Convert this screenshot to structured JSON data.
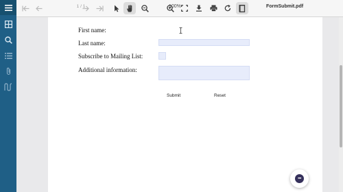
{
  "toolbar": {
    "page_indicator": "1 / 1",
    "zoom_level": "100%",
    "file_name": "FormSubmit.pdf"
  },
  "form": {
    "first_name_label": "First name:",
    "last_name_label": "Last name:",
    "subscribe_label": "Subscribe to Mailing List:",
    "additional_label": "Additional information:",
    "first_name_value": "",
    "last_name_value": "",
    "additional_value": "",
    "submit_label": "Submit",
    "reset_label": "Reset"
  },
  "colors": {
    "sidebar": "#1f5f86",
    "field_fill": "#e7ecfb",
    "chat_icon": "#35305b"
  },
  "icons": {
    "sidebar": [
      "menu-icon",
      "thumbnails-icon",
      "search-icon",
      "list-icon",
      "attachment-icon",
      "signature-icon"
    ],
    "toolbar": [
      "first-page-icon",
      "previous-page-icon",
      "next-page-icon",
      "last-page-icon",
      "select-cursor-icon",
      "pan-hand-icon",
      "zoom-out-icon",
      "zoom-in-icon",
      "fit-page-icon",
      "download-icon",
      "print-icon",
      "rotate-icon",
      "document-properties-icon"
    ],
    "chat": "chat-icon"
  }
}
